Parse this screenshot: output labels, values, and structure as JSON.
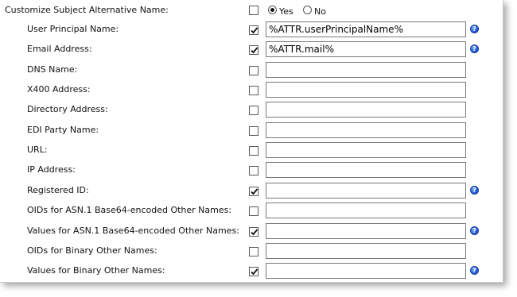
{
  "header": {
    "label": "Customize Subject Alternative Name:",
    "checkbox_checked": false,
    "radio": {
      "yes_label": "Yes",
      "no_label": "No",
      "selected": "Yes"
    }
  },
  "fields": [
    {
      "label": "User Principal Name:",
      "checked": true,
      "value": "%ATTR.userPrincipalName%",
      "help": true
    },
    {
      "label": "Email Address:",
      "checked": true,
      "value": "%ATTR.mail%",
      "help": true
    },
    {
      "label": "DNS Name:",
      "checked": false,
      "value": "",
      "help": false
    },
    {
      "label": "X400 Address:",
      "checked": false,
      "value": "",
      "help": false
    },
    {
      "label": "Directory Address:",
      "checked": false,
      "value": "",
      "help": false
    },
    {
      "label": "EDI Party Name:",
      "checked": false,
      "value": "",
      "help": false
    },
    {
      "label": "URL:",
      "checked": false,
      "value": "",
      "help": false
    },
    {
      "label": "IP Address:",
      "checked": false,
      "value": "",
      "help": false
    },
    {
      "label": "Registered ID:",
      "checked": true,
      "value": "",
      "help": true
    },
    {
      "label": "OIDs for ASN.1 Base64-encoded Other Names:",
      "checked": false,
      "value": "",
      "help": false
    },
    {
      "label": "Values for ASN.1 Base64-encoded Other Names:",
      "checked": true,
      "value": "",
      "help": true
    },
    {
      "label": "OIDs for Binary Other Names:",
      "checked": false,
      "value": "",
      "help": false
    },
    {
      "label": "Values for Binary Other Names:",
      "checked": true,
      "value": "",
      "help": true
    }
  ]
}
